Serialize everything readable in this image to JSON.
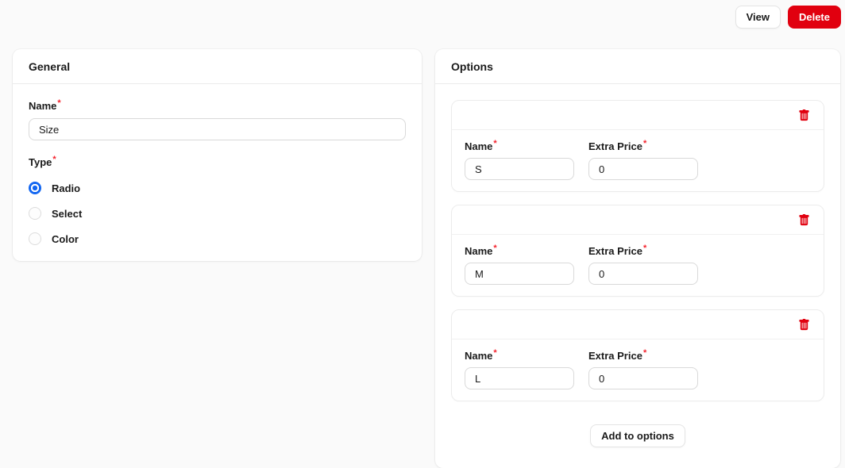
{
  "toolbar": {
    "view_label": "View",
    "delete_label": "Delete"
  },
  "general": {
    "title": "General",
    "name_label": "Name",
    "name_value": "Size",
    "required_marker": "*",
    "type_label": "Type",
    "type_options": [
      {
        "label": "Radio",
        "selected": true
      },
      {
        "label": "Select",
        "selected": false
      },
      {
        "label": "Color",
        "selected": false
      }
    ]
  },
  "options": {
    "title": "Options",
    "name_label": "Name",
    "extra_price_label": "Extra Price",
    "required_marker": "*",
    "delete_icon": "trash-icon",
    "rows": [
      {
        "name": "S",
        "extra_price": "0"
      },
      {
        "name": "M",
        "extra_price": "0"
      },
      {
        "name": "L",
        "extra_price": "0"
      }
    ],
    "add_button_label": "Add to options"
  },
  "colors": {
    "danger": "#e1000f",
    "primary": "#1266f1",
    "required": "#f5222d",
    "page_background": "#fafafa"
  }
}
